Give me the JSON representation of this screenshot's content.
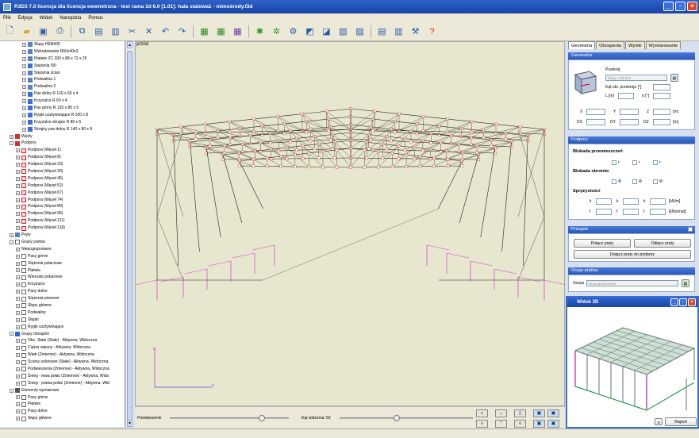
{
  "window": {
    "title": "R3D3 7.0 licencja dla licencja wewnetrzna - test rama 3d 6.0 [1.01]: hala stalowa1 - mimośrody.f3d"
  },
  "menu": [
    "Plik",
    "Edycja",
    "Widok",
    "Narzędzia",
    "Pomoc"
  ],
  "tree": {
    "rows": [
      {
        "label": "Słupy HEB400",
        "indent": 3,
        "exp": "+",
        "icon": "beam"
      },
      {
        "label": "Wykratowanie R60x40x3",
        "indent": 3,
        "exp": "+",
        "icon": "beam"
      },
      {
        "label": "Płatwie ZC 300 x 88 x 72 x 25",
        "indent": 3,
        "exp": "+",
        "icon": "beam"
      },
      {
        "label": "Stężenia f30",
        "indent": 3,
        "exp": "+",
        "icon": "blue"
      },
      {
        "label": "Stężenia ścian",
        "indent": 3,
        "exp": "+",
        "icon": "beam"
      },
      {
        "label": "Podwalina 1",
        "indent": 3,
        "exp": "+",
        "icon": "beam"
      },
      {
        "label": "Podwalina 2",
        "indent": 3,
        "exp": "+",
        "icon": "beam"
      },
      {
        "label": "Pas dolny R 120 x 60 x 4",
        "indent": 3,
        "exp": "+",
        "icon": "blue"
      },
      {
        "label": "Krzyżulce R 60 x 4",
        "indent": 3,
        "exp": "+",
        "icon": "blue"
      },
      {
        "label": "Pas górny R 120 x 80 x 5",
        "indent": 3,
        "exp": "+",
        "icon": "blue"
      },
      {
        "label": "Rygle usztywniające R 100 x 8",
        "indent": 3,
        "exp": "+",
        "icon": "blue"
      },
      {
        "label": "Krzyżulce skrajne R 80 x 5",
        "indent": 3,
        "exp": "+",
        "icon": "blue"
      },
      {
        "label": "Skrajny pas dolny R 140 x 80 x 8",
        "indent": 3,
        "exp": "+",
        "icon": "blue"
      },
      {
        "label": "Węzły",
        "indent": 1,
        "exp": "+",
        "icon": "node"
      },
      {
        "label": "Podpory",
        "indent": 1,
        "exp": "-",
        "icon": "node"
      },
      {
        "label": "Podpora (Węzeł 1)",
        "indent": 2,
        "exp": "+",
        "icon": "sup"
      },
      {
        "label": "Podpora (Węzeł 8)",
        "indent": 2,
        "exp": "+",
        "icon": "sup"
      },
      {
        "label": "Podpora (Węzeł 23)",
        "indent": 2,
        "exp": "+",
        "icon": "sup"
      },
      {
        "label": "Podpora (Węzeł 30)",
        "indent": 2,
        "exp": "+",
        "icon": "sup"
      },
      {
        "label": "Podpora (Węzeł 45)",
        "indent": 2,
        "exp": "+",
        "icon": "sup"
      },
      {
        "label": "Podpora (Węzeł 52)",
        "indent": 2,
        "exp": "+",
        "icon": "sup"
      },
      {
        "label": "Podpora (Węzeł 67)",
        "indent": 2,
        "exp": "+",
        "icon": "sup"
      },
      {
        "label": "Podpora (Węzeł 74)",
        "indent": 2,
        "exp": "+",
        "icon": "sup"
      },
      {
        "label": "Podpora (Węzeł 89)",
        "indent": 2,
        "exp": "+",
        "icon": "sup"
      },
      {
        "label": "Podpora (Węzeł 96)",
        "indent": 2,
        "exp": "+",
        "icon": "sup"
      },
      {
        "label": "Podpora (Węzeł 111)",
        "indent": 2,
        "exp": "+",
        "icon": "sup"
      },
      {
        "label": "Podpora (Węzeł 118)",
        "indent": 2,
        "exp": "+",
        "icon": "sup"
      },
      {
        "label": "Pręty",
        "indent": 1,
        "exp": "+",
        "icon": "beam"
      },
      {
        "label": "Grupy prętów",
        "indent": 1,
        "exp": "-",
        "icon": "grp"
      },
      {
        "label": "Niepogrupowane",
        "indent": 2,
        "exp": "+",
        "icon": "none"
      },
      {
        "label": "Pasy górne",
        "indent": 2,
        "exp": "+",
        "icon": "grp"
      },
      {
        "label": "Stężenia połaciowe",
        "indent": 2,
        "exp": "+",
        "icon": "grp"
      },
      {
        "label": "Płatwie",
        "indent": 2,
        "exp": "+",
        "icon": "grp"
      },
      {
        "label": "Wieszaki połaciowe",
        "indent": 2,
        "exp": "+",
        "icon": "grp"
      },
      {
        "label": "Krzyżulce",
        "indent": 2,
        "exp": "+",
        "icon": "grp"
      },
      {
        "label": "Pasy dolne",
        "indent": 2,
        "exp": "+",
        "icon": "grp"
      },
      {
        "label": "Stężenia pionowe",
        "indent": 2,
        "exp": "+",
        "icon": "grp"
      },
      {
        "label": "Słupy główne",
        "indent": 2,
        "exp": "+",
        "icon": "grp"
      },
      {
        "label": "Podwaliny",
        "indent": 2,
        "exp": "+",
        "icon": "grp"
      },
      {
        "label": "Słupki",
        "indent": 2,
        "exp": "+",
        "icon": "grp"
      },
      {
        "label": "Rygle usztywniające",
        "indent": 2,
        "exp": "+",
        "icon": "grp"
      },
      {
        "label": "Grupy obciążeń",
        "indent": 1,
        "exp": "-",
        "icon": "load"
      },
      {
        "label": "Obc. Stałe (Stałe) - Aktywna, Widoczna",
        "indent": 2,
        "exp": "+",
        "icon": "grp"
      },
      {
        "label": "Ciężar własny - Aktywna, Widoczna",
        "indent": 2,
        "exp": "+",
        "icon": "grp"
      },
      {
        "label": "Wiatr (Zmienne) - Aktywna, Widoczna",
        "indent": 2,
        "exp": "+",
        "icon": "grp"
      },
      {
        "label": "Ściany osłonowe (Stałe) - Aktywna, Widoczna",
        "indent": 2,
        "exp": "+",
        "icon": "grp"
      },
      {
        "label": "Podwieszenia (Zmienne) - Aktywna, Widoczna",
        "indent": 2,
        "exp": "+",
        "icon": "grp"
      },
      {
        "label": "Śnieg - lewa połać (Zmienne) - Aktywna, Wido",
        "indent": 2,
        "exp": "+",
        "icon": "grp"
      },
      {
        "label": "Śnieg - prawa połać (Zmienne) - Aktywna, Wid",
        "indent": 2,
        "exp": "+",
        "icon": "grp"
      },
      {
        "label": "Elementy wymiarowe",
        "indent": 1,
        "exp": "-",
        "icon": "elem"
      },
      {
        "label": "Pasy górne",
        "indent": 2,
        "exp": "+",
        "icon": "grp"
      },
      {
        "label": "Płatwie",
        "indent": 2,
        "exp": "+",
        "icon": "grp"
      },
      {
        "label": "Pasy dolne",
        "indent": 2,
        "exp": "+",
        "icon": "grp"
      },
      {
        "label": "Słupy główne",
        "indent": 2,
        "exp": "+",
        "icon": "grp"
      }
    ]
  },
  "viewport": {
    "view_name": "przód",
    "axis_x": "x",
    "axis_z": "z",
    "zoom_label": "Powiększenie",
    "angle_label": "Kąt widzenia: 52",
    "zoom_value": 0.77,
    "angle_value": 0.43
  },
  "tabs": [
    "Geometria",
    "Obciążenia",
    "Wyniki",
    "Wymiarowanie"
  ],
  "geometry": {
    "header": "Geometria",
    "section_label": "Przekrój:",
    "section_value": "Słupy HEB400",
    "angle_label": "Kąt obr. przekroju [°]",
    "L_label": "L [m]",
    "alpha_label": "α [°]",
    "X": "X",
    "Y": "Y",
    "Z": "Z",
    "m1": "[m]",
    "DX": "DX",
    "DY": "DY",
    "DZ": "DZ",
    "m2": "[m]"
  },
  "supports": {
    "header": "Podpory",
    "lock_move": "Blokada przemieszczeń",
    "lock_rot": "Blokada obrotów",
    "springs": "Sprężystości",
    "rx": "r",
    "ry": "r",
    "rz": "r",
    "px": "Φ",
    "py": "Φ",
    "pz": "Φ",
    "kx": "k",
    "ky": "k",
    "kz": "k",
    "unit1": "[kN/m]",
    "fx": "f",
    "fy": "f",
    "fz": "f",
    "unit2": "[kNm/rad]"
  },
  "joint": {
    "header": "Przegub",
    "connect": "Połącz pręty",
    "disconnect": "Odłącz pręty",
    "attach": "Dołącz pręty do podpory"
  },
  "groups": {
    "header": "Grupy prętów",
    "label": "Grupa",
    "value": "Niepogrupowane"
  },
  "view3d": {
    "title": "Widok 3D",
    "report": "Raport"
  },
  "colors": {
    "accent": "#2a59b8",
    "structure": "#000000",
    "supports": "#d23cd2",
    "node": "#e06a5a"
  }
}
